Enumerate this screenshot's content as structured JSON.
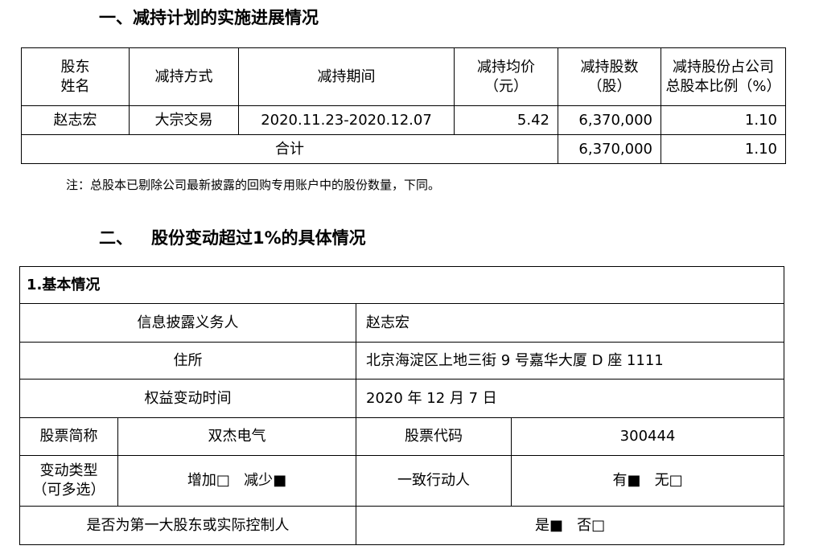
{
  "section1": {
    "heading": "一、减持计划的实施进展情况",
    "table": {
      "headers": {
        "h0_l1": "股东",
        "h0_l2": "姓名",
        "h1": "减持方式",
        "h2": "减持期间",
        "h3_l1": "减持均价",
        "h3_l2": "（元）",
        "h4_l1": "减持股数",
        "h4_l2": "（股）",
        "h5_l1": "减持股份占公司",
        "h5_l2": "总股本比例（%）"
      },
      "row": {
        "name": "赵志宏",
        "method": "大宗交易",
        "period": "2020.11.23-2020.12.07",
        "avg_price": "5.42",
        "shares": "6,370,000",
        "ratio": "1.10"
      },
      "total": {
        "label": "合计",
        "shares": "6,370,000",
        "ratio": "1.10"
      }
    },
    "note": "注：总股本已剔除公司最新披露的回购专用账户中的股份数量，下同。"
  },
  "section2": {
    "heading_num": "二、",
    "heading_text": "股份变动超过1%的具体情况",
    "table": {
      "title": "1.基本情况",
      "discloser_label": "信息披露义务人",
      "discloser_value": "赵志宏",
      "address_label": "住所",
      "address_value": "北京海淀区上地三街 9 号嘉华大厦 D 座 1111",
      "change_time_label": "权益变动时间",
      "change_time_value": "2020 年 12 月 7 日",
      "stock_abbr_label": "股票简称",
      "stock_abbr_value": "双杰电气",
      "stock_code_label": "股票代码",
      "stock_code_value": "300444",
      "change_type_label_l1": "变动类型",
      "change_type_label_l2": "（可多选）",
      "change_type_value": "增加□   减少■",
      "concert_label": "一致行动人",
      "concert_value": "有■   无□",
      "controller_label": "是否为第一大股东或实际控制人",
      "controller_value": "是■   否□"
    }
  }
}
